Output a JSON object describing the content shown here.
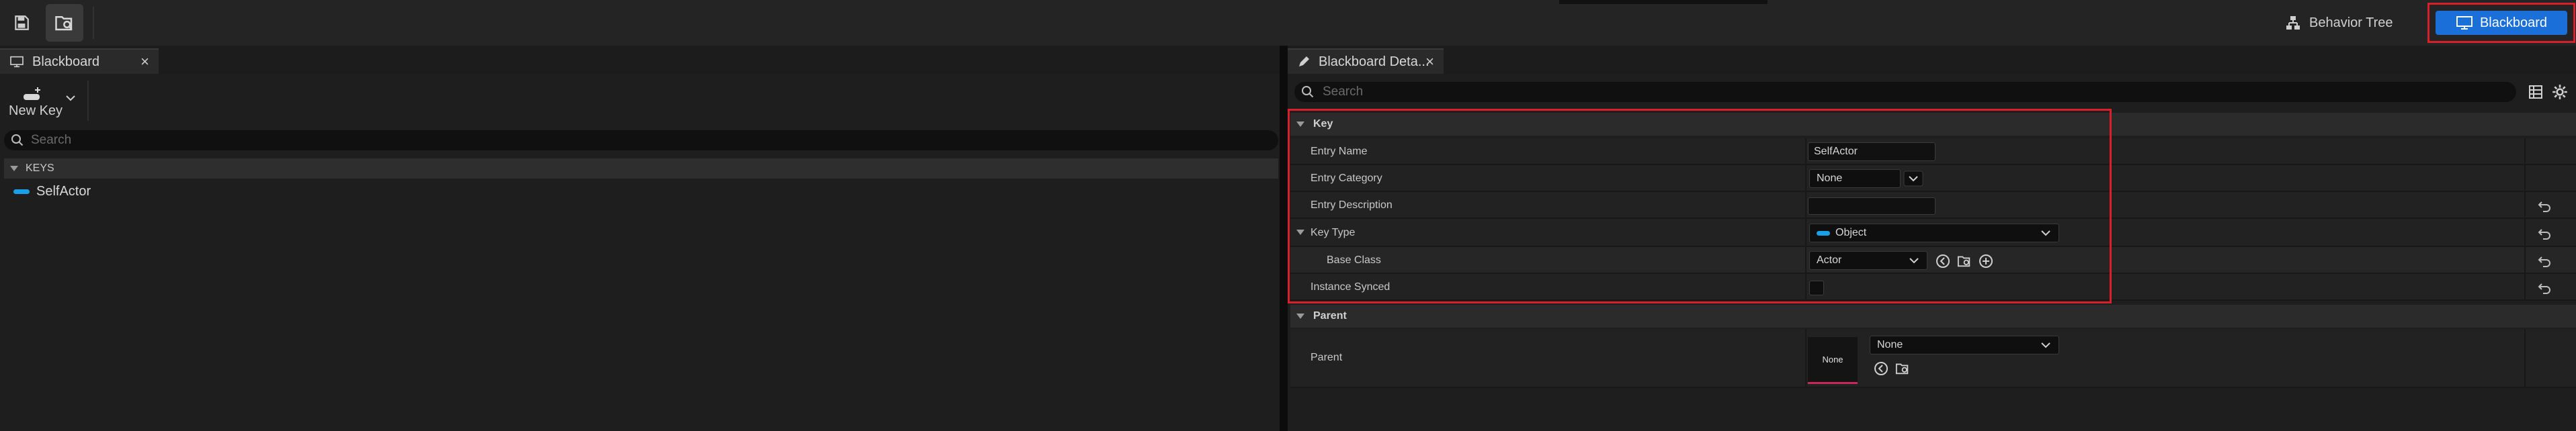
{
  "toolbar": {
    "save_icon": "save-icon",
    "browse_icon": "browse-icon",
    "modes": {
      "behavior_tree_label": "Behavior Tree",
      "blackboard_label": "Blackboard",
      "active": "Blackboard"
    },
    "accent_color": "#1a6fd8",
    "highlight_color": "#d8202a"
  },
  "left_panel": {
    "tab_label": "Blackboard",
    "tab_close": "×",
    "new_key_label": "New Key",
    "search_placeholder": "Search",
    "keys_section_label": "KEYS",
    "keys": [
      {
        "name": "SelfActor",
        "color": "#1aa0e8"
      }
    ]
  },
  "right_panel": {
    "tab_label": "Blackboard Deta...",
    "tab_close": "×",
    "search_placeholder": "Search",
    "key_category": {
      "label": "Key",
      "entry_name_label": "Entry Name",
      "entry_name_value": "SelfActor",
      "entry_category_label": "Entry Category",
      "entry_category_value": "None",
      "entry_description_label": "Entry Description",
      "entry_description_value": "",
      "key_type_label": "Key Type",
      "key_type_value": "Object",
      "base_class_label": "Base Class",
      "base_class_value": "Actor",
      "instance_synced_label": "Instance Synced",
      "instance_synced_checked": false
    },
    "parent_category": {
      "label": "Parent",
      "parent_label": "Parent",
      "parent_thumbnail": "None",
      "parent_value": "None"
    }
  }
}
